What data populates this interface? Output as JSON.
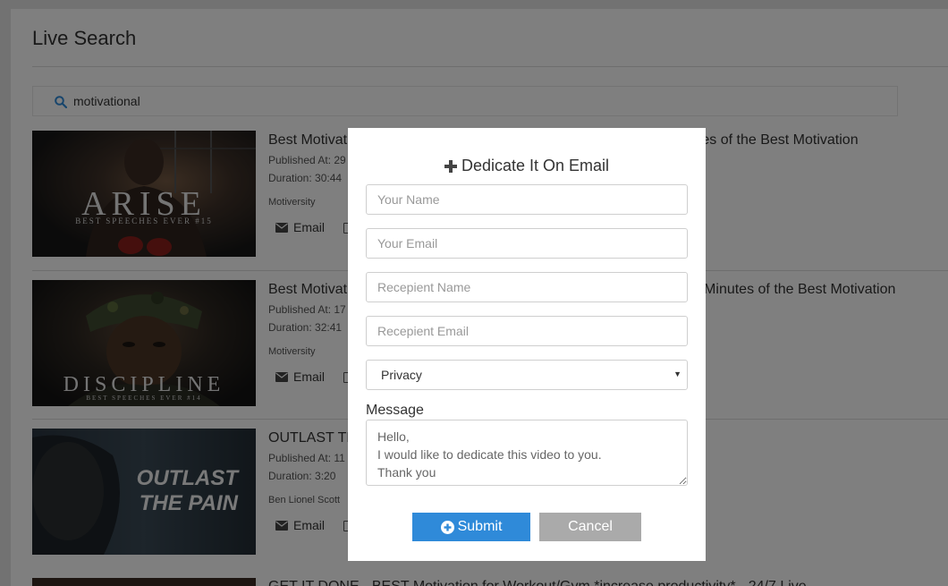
{
  "page": {
    "title": "Live Search"
  },
  "search": {
    "value": "motivational"
  },
  "results": [
    {
      "thumb_title": "ARISE",
      "thumb_sub": "BEST SPEECHES EVER #15",
      "title": "Best Motivational Speech Compilation EVER #15 - ARISE | 30 Minutes of the Best Motivation",
      "published": "Published At: 29",
      "duration": "Duration: 30:44",
      "channel": "Motiversity",
      "email_label": "Email"
    },
    {
      "thumb_title": "DISCIPLINE",
      "thumb_sub": "BEST SPEECHES EVER #14",
      "title": "Best Motivational Speech Compilation EVER #14 - DISCIPLINE | 30 Minutes of the Best Motivation",
      "published": "Published At: 17",
      "duration": "Duration: 32:41",
      "channel": "Motiversity",
      "email_label": "Email"
    },
    {
      "thumb_line1": "OUTLAST",
      "thumb_line2": "THE PAIN",
      "title": "OUTLAST THE PAIN",
      "published": "Published At: 11",
      "duration": "Duration: 3:20",
      "channel": "Ben Lionel Scott",
      "email_label": "Email"
    },
    {
      "title": "GET IT DONE - BEST Motivation for Workout/Gym *increase productivity* - 24/7 Live"
    }
  ],
  "modal": {
    "title": "Dedicate It On Email",
    "name_placeholder": "Your Name",
    "email_placeholder": "Your Email",
    "recipient_name_placeholder": "Recepient Name",
    "recipient_email_placeholder": "Recepient Email",
    "privacy_value": "Privacy",
    "message_label": "Message",
    "message_value": "Hello,\nI would like to dedicate this video to you.\nThank you",
    "submit_label": "Submit",
    "cancel_label": "Cancel"
  },
  "colors": {
    "primary": "#2f8ad9",
    "cancel": "#aaaaaa",
    "overlay": "rgba(0,0,0,0.5)"
  }
}
